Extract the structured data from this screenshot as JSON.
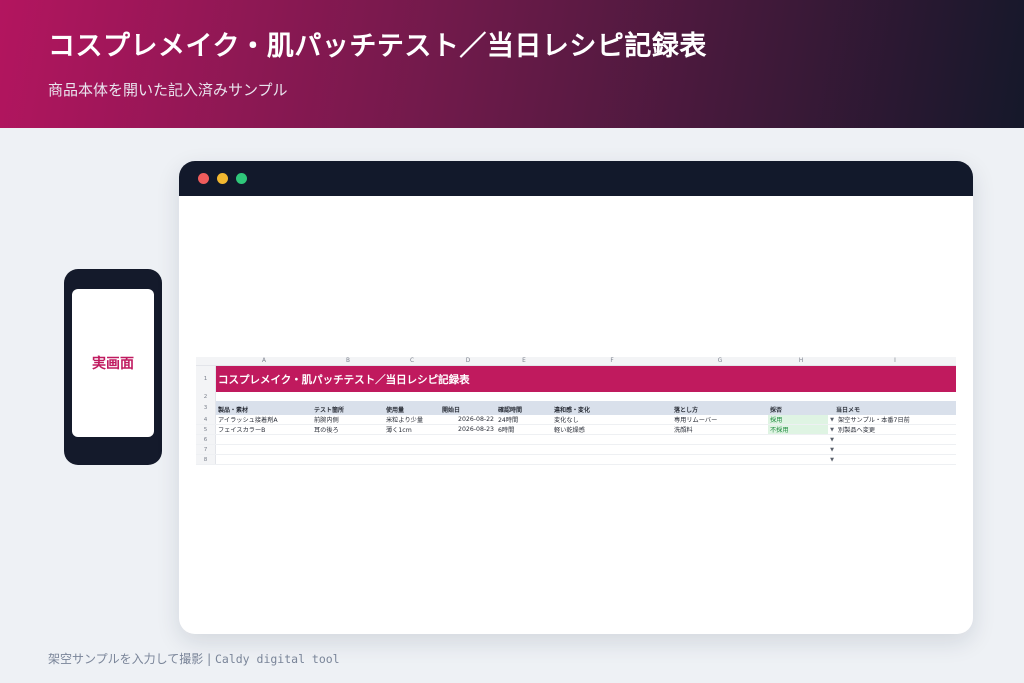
{
  "banner": {
    "title": "コスプレメイク・肌パッチテスト／当日レシピ記録表",
    "subtitle": "商品本体を開いた記入済みサンプル"
  },
  "phone": {
    "label": "実画面"
  },
  "sheet": {
    "columns": [
      "A",
      "B",
      "C",
      "D",
      "E",
      "F",
      "G",
      "H",
      "I"
    ],
    "row_numbers": [
      "1",
      "2",
      "3",
      "4",
      "5",
      "6",
      "7",
      "8"
    ],
    "title": "コスプレメイク・肌パッチテスト／当日レシピ記録表",
    "headers": [
      "製品・素材",
      "テスト箇所",
      "使用量",
      "開始日",
      "確認時間",
      "違和感・変化",
      "落とし方",
      "採否",
      "当日メモ"
    ],
    "rows": [
      [
        "アイラッシュ接着剤A",
        "前腕内側",
        "米粒より少量",
        "2026-08-22",
        "24時間",
        "変化なし",
        "専用リムーバー",
        "採用",
        "架空サンプル・本番7日前"
      ],
      [
        "フェイスカラーB",
        "耳の後ろ",
        "薄く1cm",
        "2026-08-23",
        "6時間",
        "軽い乾燥感",
        "洗顔料",
        "不採用",
        "別製品へ変更"
      ]
    ],
    "dropdown_glyph": "▼",
    "accent_color": "#c01a5e",
    "header_color": "#d9e0eb"
  },
  "footer": {
    "caption": "架空サンプルを入力して撮影",
    "separator": "|",
    "brand": "Caldy digital tool"
  }
}
